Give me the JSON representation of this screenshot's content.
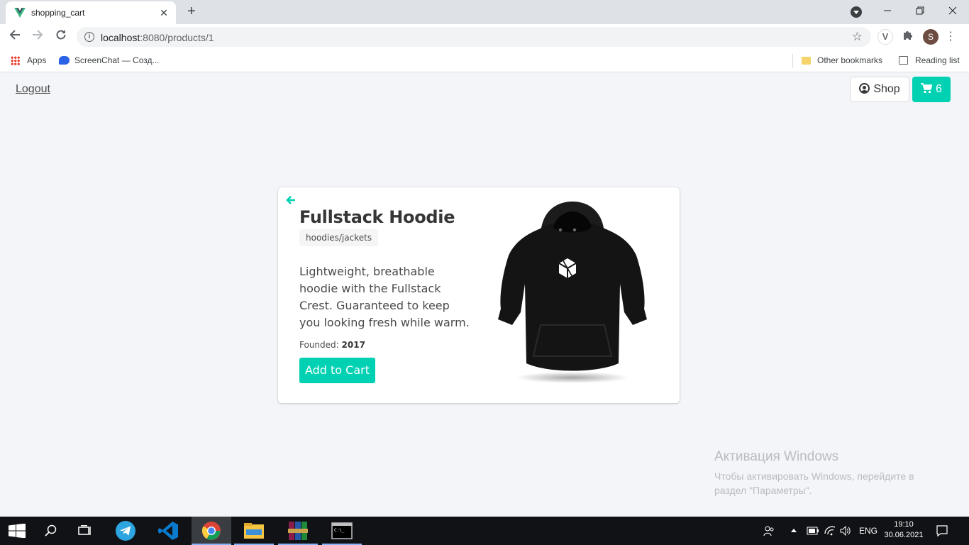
{
  "browser": {
    "tab_title": "shopping_cart",
    "tab_close": "✕",
    "new_tab": "+",
    "url_host": "localhost",
    "url_path": ":8080/products/1",
    "profile_initial": "S",
    "extension_letter": "V"
  },
  "bookmarks": {
    "apps": "Apps",
    "screenchat": "ScreenChat — Созд...",
    "other": "Other bookmarks",
    "reading_list": "Reading list"
  },
  "nav": {
    "logout": "Logout",
    "shop": "Shop",
    "cart_count": "6"
  },
  "product": {
    "title": "Fullstack Hoodie",
    "tag": "hoodies/jackets",
    "description": "Lightweight, breathable hoodie with the Fullstack Crest. Guaranteed to keep you looking fresh while warm.",
    "founded_label": "Founded:",
    "founded_year": "2017",
    "add_to_cart": "Add to Cart"
  },
  "activation": {
    "title": "Активация Windows",
    "subtitle": "Чтобы активировать Windows, перейдите в раздел \"Параметры\"."
  },
  "taskbar": {
    "language": "ENG",
    "time": "19:10",
    "date": "30.06.2021"
  },
  "colors": {
    "accent": "#00d1b2",
    "title_text": "#363636",
    "page_bg": "#f3f5f8",
    "taskbar_bg": "#101216"
  }
}
